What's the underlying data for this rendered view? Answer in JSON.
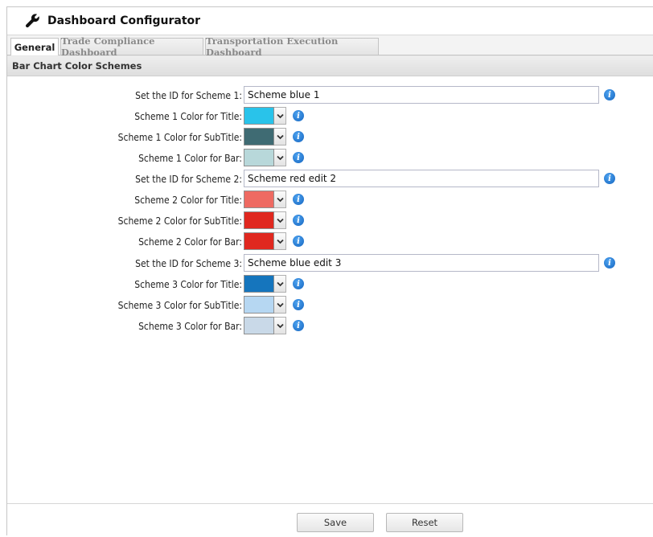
{
  "window": {
    "title": "Dashboard Configurator",
    "icon": "wrench-icon"
  },
  "tabs": [
    {
      "label": "General",
      "active": true
    },
    {
      "label": "Trade Compliance Dashboard",
      "active": false
    },
    {
      "label": "Transportation Execution Dashboard",
      "active": false
    }
  ],
  "section": {
    "title": "Bar Chart Color Schemes"
  },
  "schemes": [
    {
      "id_label": "Set the ID for Scheme 1:",
      "id_value": "Scheme blue 1",
      "title_label": "Scheme 1 Color for Title:",
      "title_color": "#29c3ea",
      "subtitle_label": "Scheme 1 Color for SubTitle:",
      "subtitle_color": "#3f6b73",
      "bar_label": "Scheme 1 Color for Bar:",
      "bar_color": "#b8d8da"
    },
    {
      "id_label": "Set the ID for Scheme 2:",
      "id_value": "Scheme red edit 2",
      "title_label": "Scheme 2 Color for Title:",
      "title_color": "#ee6a62",
      "subtitle_label": "Scheme 2 Color for SubTitle:",
      "subtitle_color": "#e0281f",
      "bar_label": "Scheme 2 Color for Bar:",
      "bar_color": "#e0281f"
    },
    {
      "id_label": "Set the ID for Scheme 3:",
      "id_value": "Scheme blue edit 3",
      "title_label": "Scheme 3 Color for Title:",
      "title_color": "#1575bd",
      "subtitle_label": "Scheme 3 Color for SubTitle:",
      "subtitle_color": "#b6d7f2",
      "bar_label": "Scheme 3 Color for Bar:",
      "bar_color": "#c9d9e8"
    }
  ],
  "footer": {
    "save_label": "Save",
    "reset_label": "Reset"
  },
  "colors": {
    "info_icon": "#1a73d0",
    "field_border": "#b5b8c8"
  }
}
